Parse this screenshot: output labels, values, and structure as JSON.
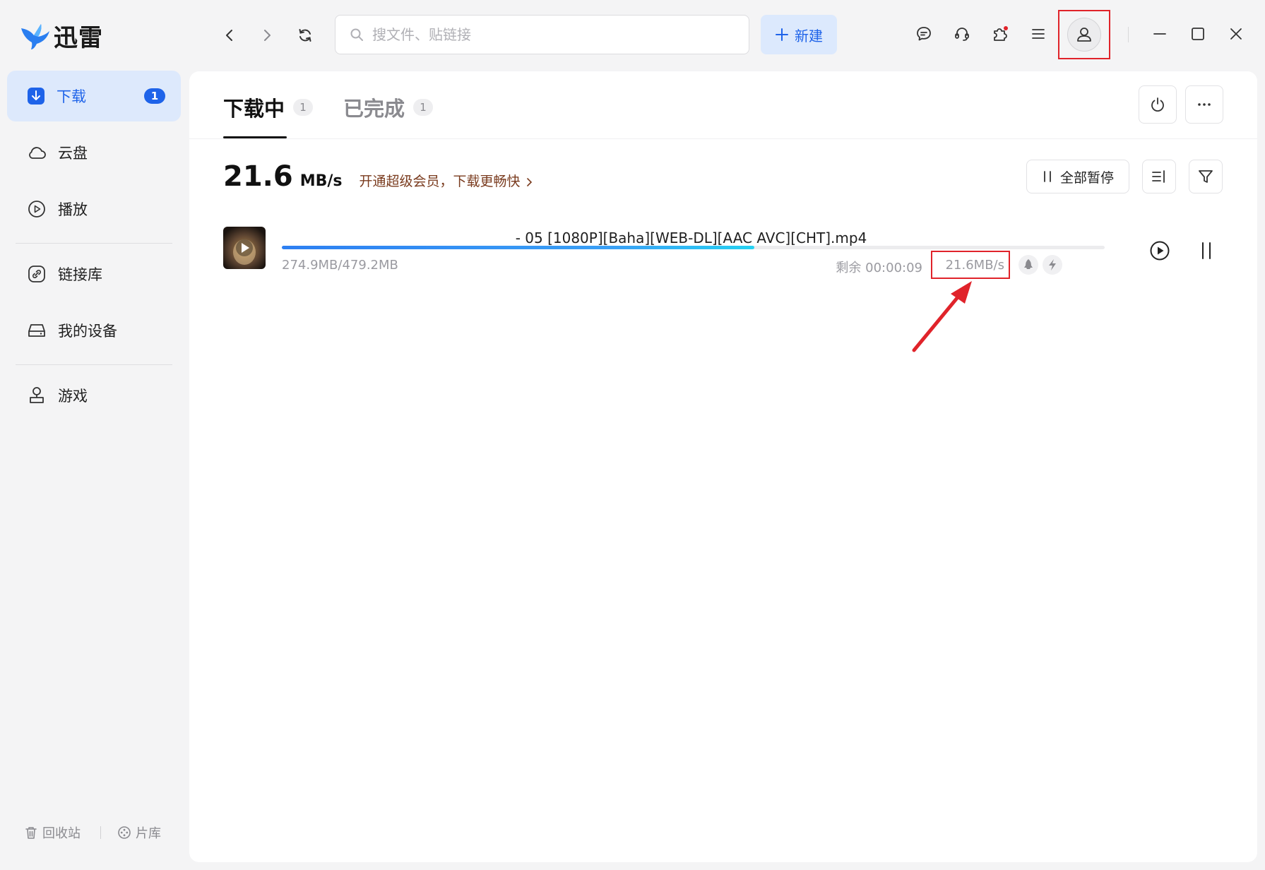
{
  "app": {
    "name": "迅雷"
  },
  "toolbar": {
    "search_placeholder": "搜文件、贴链接",
    "new_label": "新建",
    "icons": [
      "back-icon",
      "forward-icon",
      "refresh-icon",
      "chat-icon",
      "support-icon",
      "plugin-icon",
      "menu-icon",
      "user-icon",
      "minimize-icon",
      "maximize-icon",
      "close-icon"
    ]
  },
  "sidebar": {
    "items": [
      {
        "label": "下载",
        "badge": "1",
        "icon": "download-icon",
        "active": true
      },
      {
        "label": "云盘",
        "icon": "cloud-icon"
      },
      {
        "label": "播放",
        "icon": "play-icon"
      },
      {
        "label": "链接库",
        "icon": "link-icon"
      },
      {
        "label": "我的设备",
        "icon": "device-icon"
      },
      {
        "label": "游戏",
        "icon": "game-icon"
      }
    ],
    "bottom": {
      "recycle_label": "回收站",
      "library_label": "片库"
    }
  },
  "main": {
    "tabs": [
      {
        "label": "下载中",
        "count": "1",
        "active": true
      },
      {
        "label": "已完成",
        "count": "1"
      }
    ],
    "speed": {
      "value": "21.6",
      "unit": "MB/s",
      "vip_text": "开通超级会员，下载更畅快"
    },
    "pause_all_label": "全部暂停",
    "tasks": [
      {
        "filename": "- 05 [1080P][Baha][WEB-DL][AAC AVC][CHT].mp4",
        "progress": 0.574,
        "size": "274.9MB/479.2MB",
        "remaining": "剩余 00:00:09",
        "rate": "21.6MB/s"
      }
    ]
  },
  "colors": {
    "accent": "#1e63e9",
    "highlight": "#e0232a",
    "vip": "#7a3b1e"
  }
}
